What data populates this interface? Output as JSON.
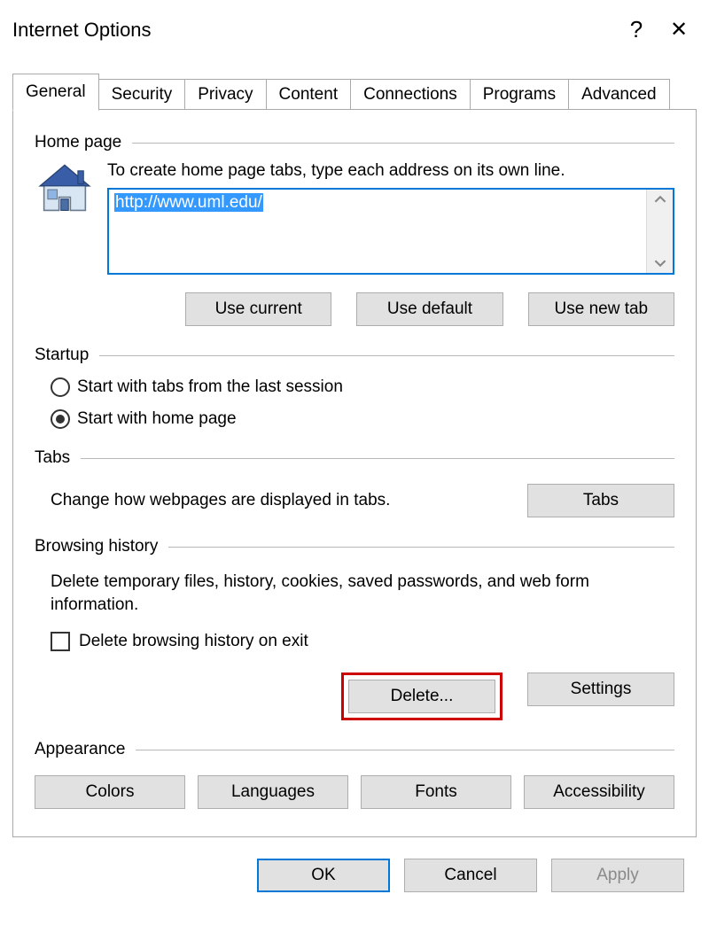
{
  "window": {
    "title": "Internet Options",
    "help": "?",
    "close": "✕"
  },
  "tabs": [
    "General",
    "Security",
    "Privacy",
    "Content",
    "Connections",
    "Programs",
    "Advanced"
  ],
  "active_tab": "General",
  "homepage": {
    "heading": "Home page",
    "instruction": "To create home page tabs, type each address on its own line.",
    "value": "http://www.uml.edu/",
    "btn_use_current": "Use current",
    "btn_use_default": "Use default",
    "btn_use_new_tab": "Use new tab"
  },
  "startup": {
    "heading": "Startup",
    "opt_last_session": "Start with tabs from the last session",
    "opt_home_page": "Start with home page",
    "selected": "home_page"
  },
  "tabs_section": {
    "heading": "Tabs",
    "text": "Change how webpages are displayed in tabs.",
    "btn_tabs": "Tabs"
  },
  "browsing_history": {
    "heading": "Browsing history",
    "text": "Delete temporary files, history, cookies, saved passwords, and web form information.",
    "chk_label": "Delete browsing history on exit",
    "chk_checked": false,
    "btn_delete": "Delete...",
    "btn_settings": "Settings"
  },
  "appearance": {
    "heading": "Appearance",
    "btn_colors": "Colors",
    "btn_languages": "Languages",
    "btn_fonts": "Fonts",
    "btn_accessibility": "Accessibility"
  },
  "footer": {
    "ok": "OK",
    "cancel": "Cancel",
    "apply": "Apply"
  }
}
